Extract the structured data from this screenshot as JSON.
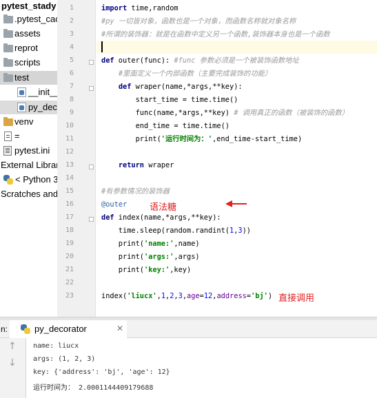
{
  "project_tree": {
    "title": "pytest_stady",
    "items": [
      {
        "label": ".pytest_cac",
        "icon": "folder-icon"
      },
      {
        "label": "assets",
        "icon": "folder-icon"
      },
      {
        "label": "reprot",
        "icon": "folder-icon"
      },
      {
        "label": "scripts",
        "icon": "folder-icon"
      },
      {
        "label": "test",
        "icon": "folder-icon"
      },
      {
        "label": "__init__",
        "icon": "python-file-icon"
      },
      {
        "label": "py_decc",
        "icon": "python-file-icon"
      },
      {
        "label": "venv",
        "icon": "folder-icon"
      },
      {
        "label": "=",
        "icon": "file-icon"
      },
      {
        "label": "pytest.ini",
        "icon": "config-file-icon"
      },
      {
        "label": "External Librar",
        "icon": "library-icon"
      },
      {
        "label": "< Python 3",
        "icon": "python-icon"
      },
      {
        "label": "Scratches and",
        "icon": "scratch-icon"
      }
    ]
  },
  "editor": {
    "line_numbers": [
      "1",
      "2",
      "3",
      "4",
      "5",
      "6",
      "7",
      "8",
      "9",
      "10",
      "11",
      "12",
      "13",
      "14",
      "15",
      "16",
      "17",
      "18",
      "19",
      "20",
      "21",
      "22",
      "23"
    ],
    "current_line": "4",
    "lines": [
      [
        "import",
        " time,random"
      ],
      [
        "#py 一切皆对象，函数也是一个对象，而函数名称就对象名称"
      ],
      [
        "#所谓的装饰器：就是在函数中定义另一个函数,装饰器本身也是一个函数"
      ],
      [
        ""
      ],
      [
        "def",
        " outer(func): ",
        "#func 参数必须是一个被装饰函数地址"
      ],
      [
        "    ",
        "#里面定义一个内部函数（主要完成装饰的功能）"
      ],
      [
        "    ",
        "def",
        " wraper(name,*args,**key):"
      ],
      [
        "        start_time = time.time()"
      ],
      [
        "        func(name,*args,**key) ",
        "# 调用真正的函数（被装饰的函数）"
      ],
      [
        "        end_time = time.time()"
      ],
      [
        "        print(",
        "'运行时间为：'",
        ",end_time-start_time)"
      ],
      [
        ""
      ],
      [
        "    ",
        "return",
        " wraper"
      ],
      [
        ""
      ],
      [
        "#有参数情况的装饰器"
      ],
      [
        "@outer"
      ],
      [
        "def",
        " index(name,*args,**key):"
      ],
      [
        "    time.sleep(random.randint(",
        "1",
        ",",
        "3",
        "))"
      ],
      [
        "    print(",
        "'name:'",
        ",name)"
      ],
      [
        "    print(",
        "'args:'",
        ",args)"
      ],
      [
        "    print(",
        "'key:'",
        ",key)"
      ],
      [
        ""
      ],
      [
        "index(",
        "'liucx'",
        ",",
        "1",
        ",",
        "2",
        ",",
        "3",
        ",",
        "age",
        "=",
        "12",
        ",",
        "address",
        "=",
        "'bj'",
        ")"
      ]
    ],
    "annotations": {
      "decorator_syntax": "语法糖",
      "direct_call": "直接调用"
    },
    "colors": {
      "keyword": "#000080",
      "comment": "#9a9a9a",
      "string": "#008000",
      "number": "#0000ff",
      "annotation": "#e02020",
      "current_line_bg": "#fffae3"
    }
  },
  "run_panel": {
    "label": "n:",
    "tab_title": "py_decorator",
    "output": [
      "name: liucx",
      "args: (1, 2, 3)",
      "key: {'address': 'bj', 'age': 12}",
      "运行时间为： 2.0001144409179688"
    ]
  }
}
